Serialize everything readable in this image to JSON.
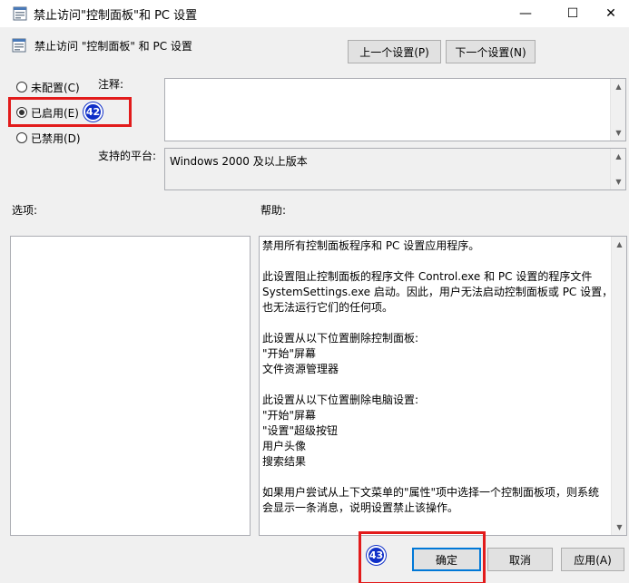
{
  "window": {
    "title": "禁止访问\"控制面板\"和 PC 设置",
    "controls": {
      "minimize": "—",
      "maximize": "☐",
      "close": "✕"
    }
  },
  "dialog": {
    "header": "禁止访问 \"控制面板\" 和 PC 设置",
    "prev_button": "上一个设置(P)",
    "next_button": "下一个设置(N)",
    "radios": [
      {
        "label": "未配置(C)",
        "checked": false
      },
      {
        "label": "已启用(E)",
        "checked": true
      },
      {
        "label": "已禁用(D)",
        "checked": false
      }
    ],
    "comment_label": "注释:",
    "comment_value": "",
    "platform_label": "支持的平台:",
    "platform_value": "Windows 2000 及以上版本",
    "options_label": "选项:",
    "help_label": "帮助:",
    "help_lines": [
      "禁用所有控制面板程序和 PC 设置应用程序。",
      "",
      "此设置阻止控制面板的程序文件 Control.exe 和 PC 设置的程序文件",
      "SystemSettings.exe 启动。因此，用户无法启动控制面板或 PC 设置，",
      "也无法运行它们的任何项。",
      "",
      "此设置从以下位置删除控制面板:",
      "\"开始\"屏幕",
      "文件资源管理器",
      "",
      "此设置从以下位置删除电脑设置:",
      "\"开始\"屏幕",
      "\"设置\"超级按钮",
      "用户头像",
      "搜索结果",
      "",
      "如果用户尝试从上下文菜单的\"属性\"项中选择一个控制面板项，则系统",
      "会显示一条消息，说明设置禁止该操作。"
    ],
    "ok_button": "确定",
    "cancel_button": "取消",
    "apply_button": "应用(A)"
  },
  "annotations": {
    "badge_1": "42",
    "badge_2": "43",
    "highlight_color": "#e21b1b",
    "badge_color": "#1030c8"
  },
  "icons": {
    "title": "policy-settings-icon",
    "header": "policy-settings-icon",
    "scroll_up": "triangle-up-icon",
    "scroll_down": "triangle-down-icon"
  }
}
